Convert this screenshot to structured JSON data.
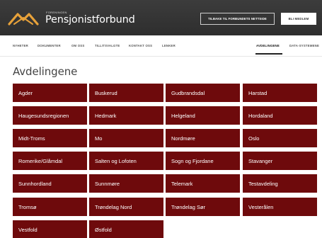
{
  "header": {
    "logo_small": "FORENINGEN",
    "logo_text": "Pensjonistforbund",
    "back_button": "TILBAKE TIL FORBUNDETS NETTSIDE",
    "member_button": "BLI MEDLEM"
  },
  "nav": {
    "items": [
      "NYHETER",
      "DOKUMENTER",
      "OM OSS",
      "TILLITSVALGTE",
      "KONTAKT OSS",
      "LENKER"
    ],
    "right_items": [
      "AVDELINGENE",
      "DATA-SYSTEMENE"
    ],
    "active": "AVDELINGENE"
  },
  "page": {
    "title": "Avdelingene"
  },
  "departments": [
    "Agder",
    "Buskerud",
    "Gudbrandsdal",
    "Harstad",
    "Haugesundsregionen",
    "Hedmark",
    "Helgeland",
    "Hordaland",
    "Midt-Troms",
    "Mo",
    "Nordmøre",
    "Oslo",
    "Romerike/Glåmdal",
    "Salten og Lofoten",
    "Sogn og Fjordane",
    "Stavanger",
    "Sunnhordland",
    "Sunnmøre",
    "Telemark",
    "Testavdeling",
    "Tromsø",
    "Trøndelag Nord",
    "Trøndelag Sør",
    "Vesterålen",
    "Vestfold",
    "Østfold"
  ],
  "colors": {
    "tile": "#6e0a0c",
    "header": "#333333",
    "logo_accent": "#e8a23a"
  },
  "icons": {
    "logo": "wing-logo-icon"
  }
}
